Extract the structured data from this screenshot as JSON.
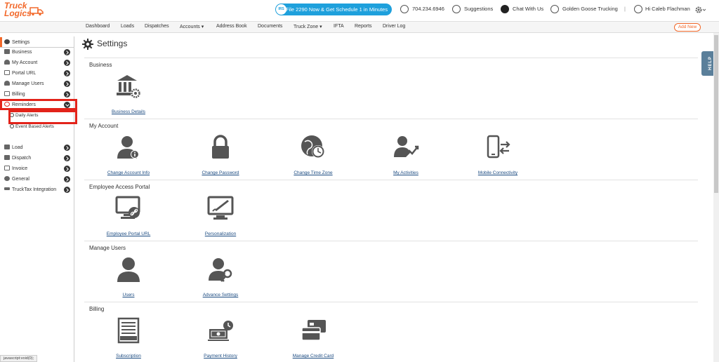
{
  "app": {
    "logo_line1": "Truck",
    "logo_line2": "Logics",
    "brand_color": "#f2682a",
    "promo": "File 2290 Now & Get Schedule 1 in Minutes",
    "promo_badge": "IRS",
    "phone": "704.234.6946",
    "suggestions": "Suggestions",
    "chat": "Chat With Us",
    "company": "Golden Goose Trucking",
    "separator": "|",
    "greeting": "Hi Caleb Flachman"
  },
  "nav": {
    "items": [
      "Dashboard",
      "Loads",
      "Dispatches",
      "Accounts ▾",
      "Address Book",
      "Documents",
      "Truck Zone ▾",
      "IFTA",
      "Reports",
      "Driver Log"
    ],
    "add_new": "Add New"
  },
  "sidebar": {
    "header": "Settings",
    "items": [
      {
        "label": "Business",
        "icon": "bank-icon"
      },
      {
        "label": "My Account",
        "icon": "user-icon"
      },
      {
        "label": "Portal URL",
        "icon": "monitor-icon"
      },
      {
        "label": "Manage Users",
        "icon": "users-icon"
      },
      {
        "label": "Billing",
        "icon": "billing-icon"
      },
      {
        "label": "Reminders",
        "icon": "alarm-icon"
      }
    ],
    "sub_items": [
      "Daily Alerts",
      "Event Based Alerts"
    ],
    "items2": [
      {
        "label": "Load",
        "icon": "load-icon"
      },
      {
        "label": "Dispatch",
        "icon": "dispatch-icon"
      },
      {
        "label": "Invoice",
        "icon": "invoice-icon"
      },
      {
        "label": "General",
        "icon": "globe-icon"
      },
      {
        "label": "TruckTax Integration",
        "icon": "truck-icon"
      }
    ]
  },
  "main": {
    "title": "Settings",
    "sections": [
      {
        "title": "Business",
        "tiles": [
          "Business Details"
        ]
      },
      {
        "title": "My Account",
        "tiles": [
          "Change Account Info",
          "Change Password",
          "Change Time Zone",
          "My Activities",
          "Mobile Connectivity"
        ]
      },
      {
        "title": "Employee Access Portal",
        "tiles": [
          "Employee Portal URL",
          "Personalization"
        ]
      },
      {
        "title": "Manage Users",
        "tiles": [
          "Users",
          "Advance Settings"
        ]
      },
      {
        "title": "Billing",
        "tiles": [
          "Subscription",
          "Payment History",
          "Manage Credit Card"
        ]
      }
    ]
  },
  "help": "HELP",
  "status_bar": "javascript:void(0);",
  "colors": {
    "highlight": "#e2231a",
    "link": "#1a4a80",
    "promo": "#1ea0dc"
  }
}
